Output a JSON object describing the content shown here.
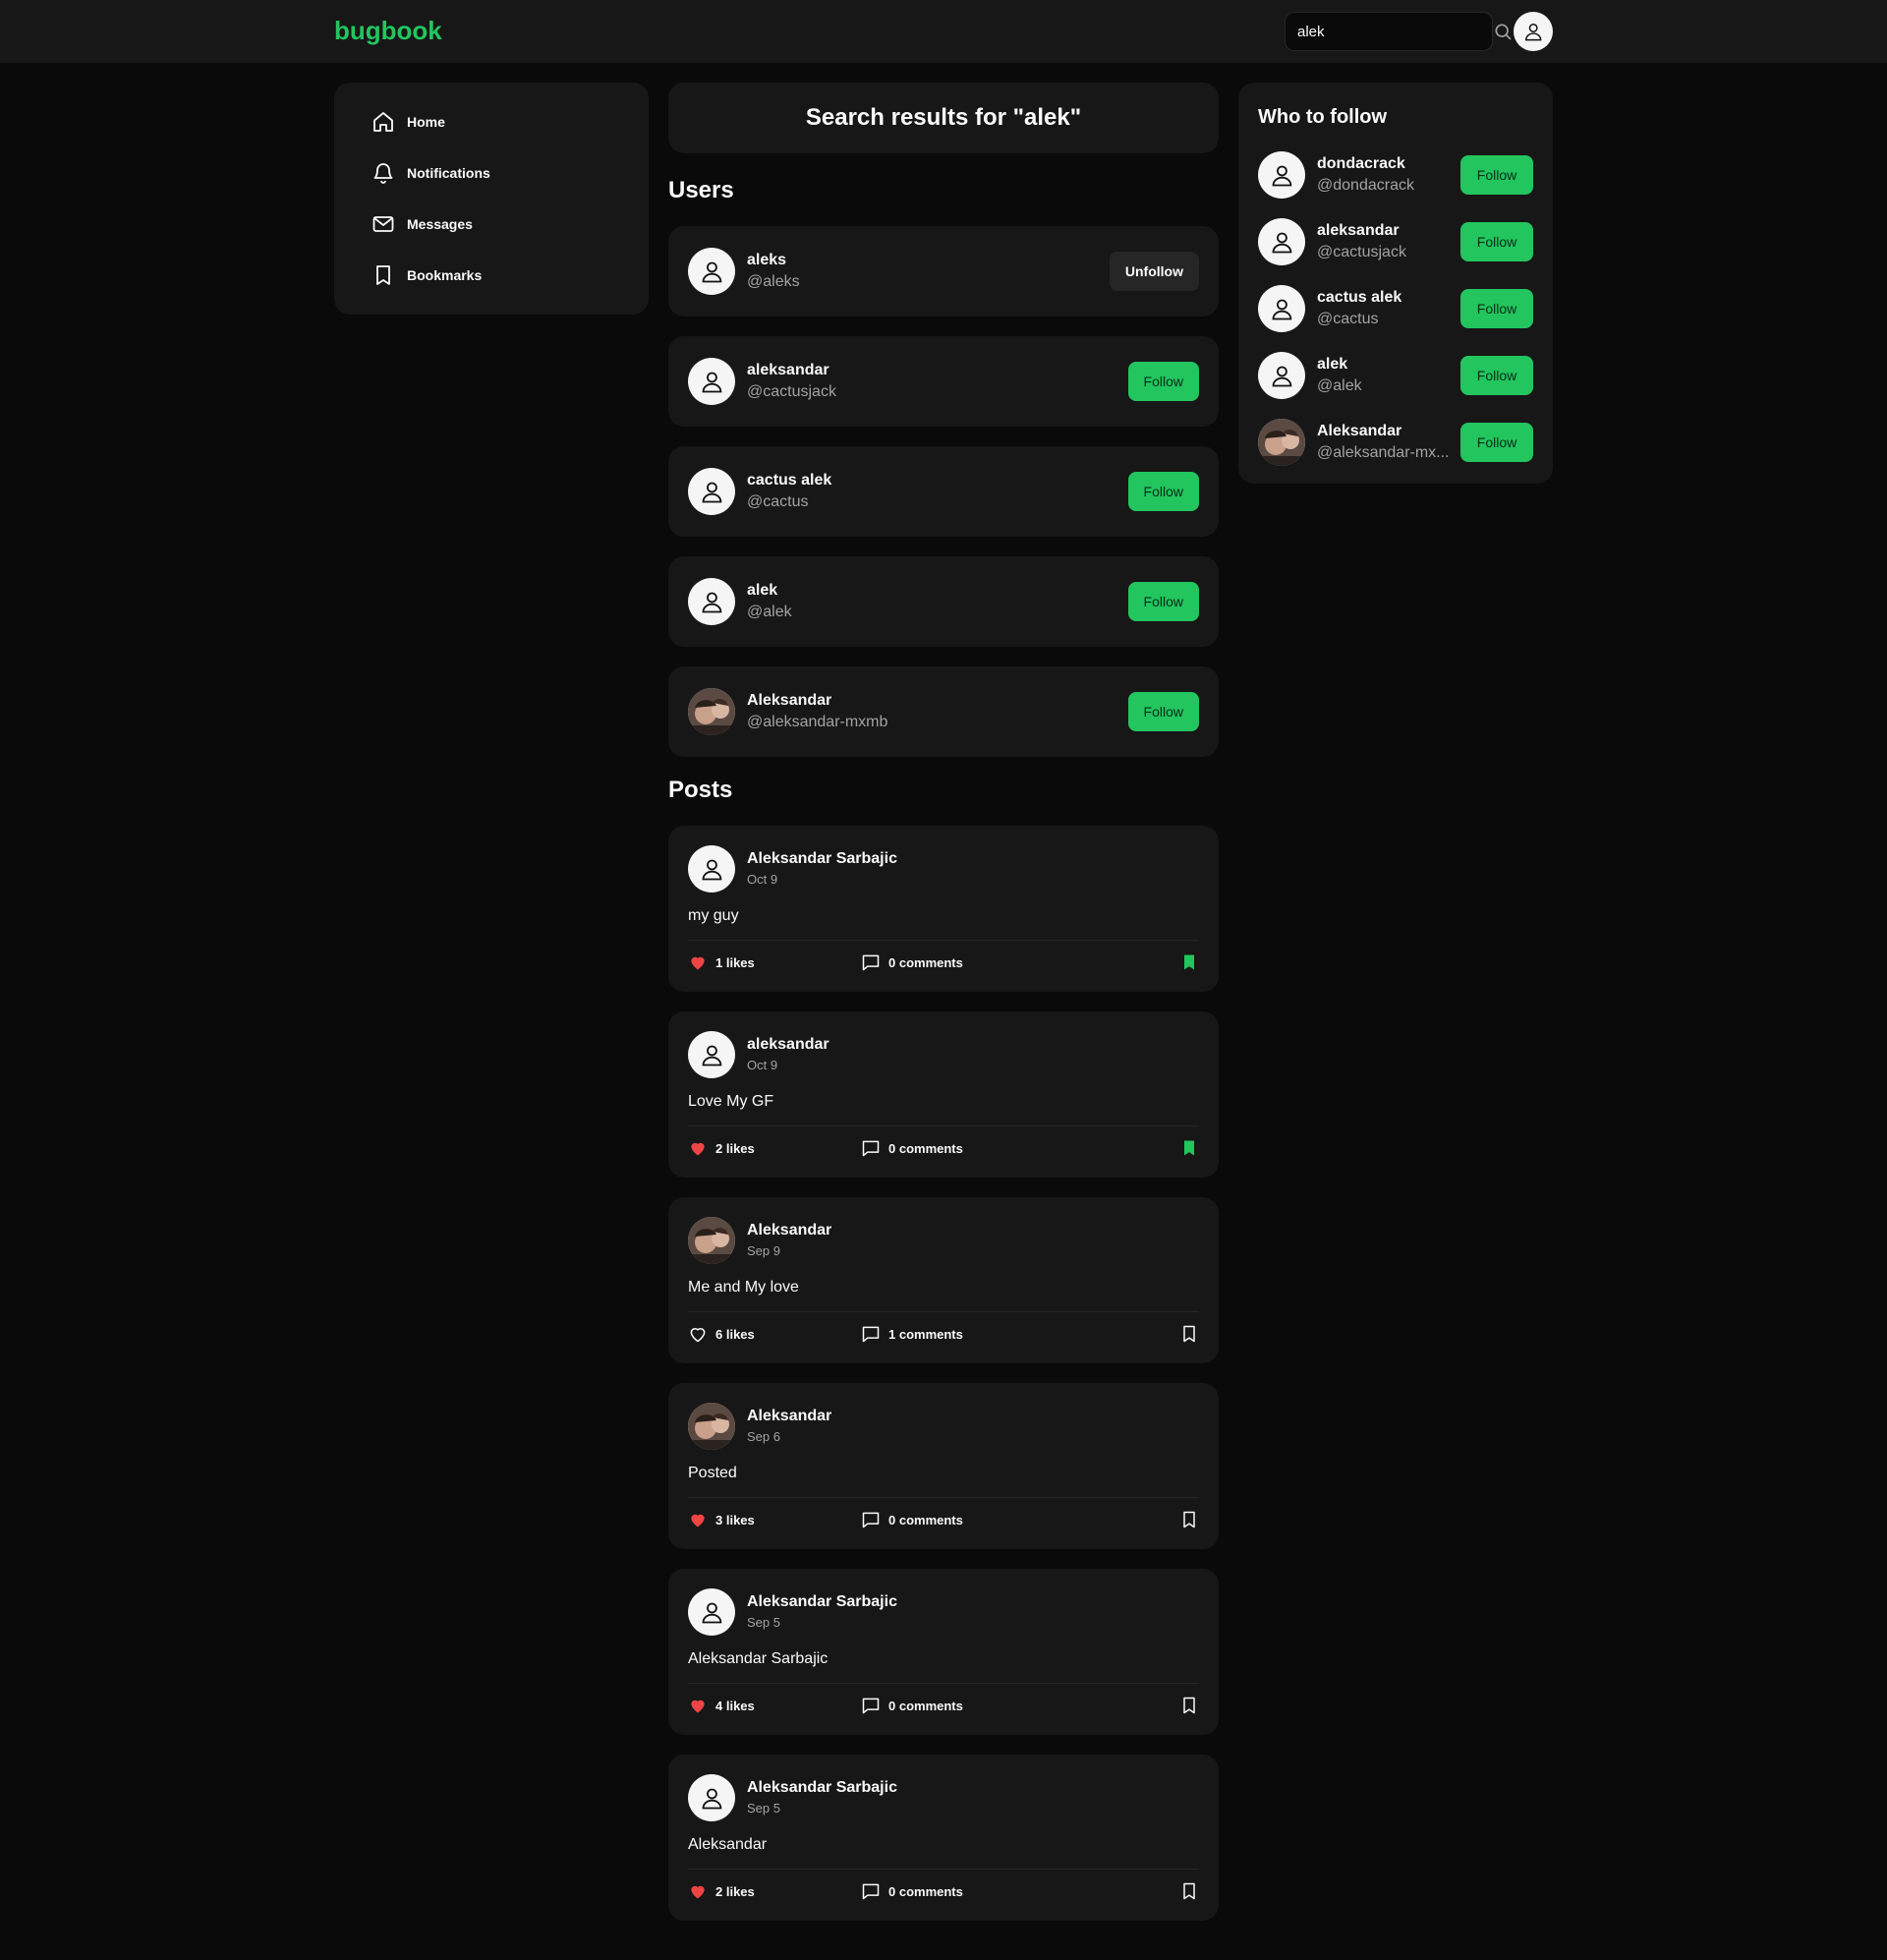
{
  "header": {
    "logo": "bugbook",
    "search_value": "alek"
  },
  "nav": {
    "items": [
      {
        "label": "Home",
        "icon": "home-icon"
      },
      {
        "label": "Notifications",
        "icon": "bell-icon"
      },
      {
        "label": "Messages",
        "icon": "mail-icon"
      },
      {
        "label": "Bookmarks",
        "icon": "bookmark-icon"
      }
    ]
  },
  "main": {
    "title": "Search results for \"alek\"",
    "users_heading": "Users",
    "posts_heading": "Posts",
    "users": [
      {
        "name": "aleks",
        "handle": "@aleks",
        "button": "Unfollow",
        "avatar": "default"
      },
      {
        "name": "aleksandar",
        "handle": "@cactusjack",
        "button": "Follow",
        "avatar": "default"
      },
      {
        "name": "cactus alek",
        "handle": "@cactus",
        "button": "Follow",
        "avatar": "default"
      },
      {
        "name": "alek",
        "handle": "@alek",
        "button": "Follow",
        "avatar": "default"
      },
      {
        "name": "Aleksandar",
        "handle": "@aleksandar-mxmb",
        "button": "Follow",
        "avatar": "photo"
      }
    ],
    "posts": [
      {
        "author": "Aleksandar Sarbajic",
        "date": "Oct 9",
        "body": "my guy",
        "likes": "1 likes",
        "liked": true,
        "comments": "0 comments",
        "bookmarked": true,
        "avatar": "default"
      },
      {
        "author": "aleksandar",
        "date": "Oct 9",
        "body": "Love My GF",
        "likes": "2 likes",
        "liked": true,
        "comments": "0 comments",
        "bookmarked": true,
        "avatar": "default"
      },
      {
        "author": "Aleksandar",
        "date": "Sep 9",
        "body": "Me and My love",
        "likes": "6 likes",
        "liked": false,
        "comments": "1 comments",
        "bookmarked": false,
        "avatar": "photo"
      },
      {
        "author": "Aleksandar",
        "date": "Sep 6",
        "body": "Posted",
        "likes": "3 likes",
        "liked": true,
        "comments": "0 comments",
        "bookmarked": false,
        "avatar": "photo"
      },
      {
        "author": "Aleksandar Sarbajic",
        "date": "Sep 5",
        "body": "Aleksandar Sarbajic",
        "likes": "4 likes",
        "liked": true,
        "comments": "0 comments",
        "bookmarked": false,
        "avatar": "default"
      },
      {
        "author": "Aleksandar Sarbajic",
        "date": "Sep 5",
        "body": "Aleksandar",
        "likes": "2 likes",
        "liked": true,
        "comments": "0 comments",
        "bookmarked": false,
        "avatar": "default"
      }
    ]
  },
  "who_to_follow": {
    "title": "Who to follow",
    "users": [
      {
        "name": "dondacrack",
        "handle": "@dondacrack",
        "button": "Follow",
        "avatar": "default"
      },
      {
        "name": "aleksandar",
        "handle": "@cactusjack",
        "button": "Follow",
        "avatar": "default"
      },
      {
        "name": "cactus alek",
        "handle": "@cactus",
        "button": "Follow",
        "avatar": "default"
      },
      {
        "name": "alek",
        "handle": "@alek",
        "button": "Follow",
        "avatar": "default"
      },
      {
        "name": "Aleksandar",
        "handle": "@aleksandar-mx...",
        "button": "Follow",
        "avatar": "photo"
      }
    ]
  },
  "colors": {
    "accent": "#22c55e",
    "background": "#0a0a0a",
    "card": "#171717",
    "like": "#ef4444"
  }
}
